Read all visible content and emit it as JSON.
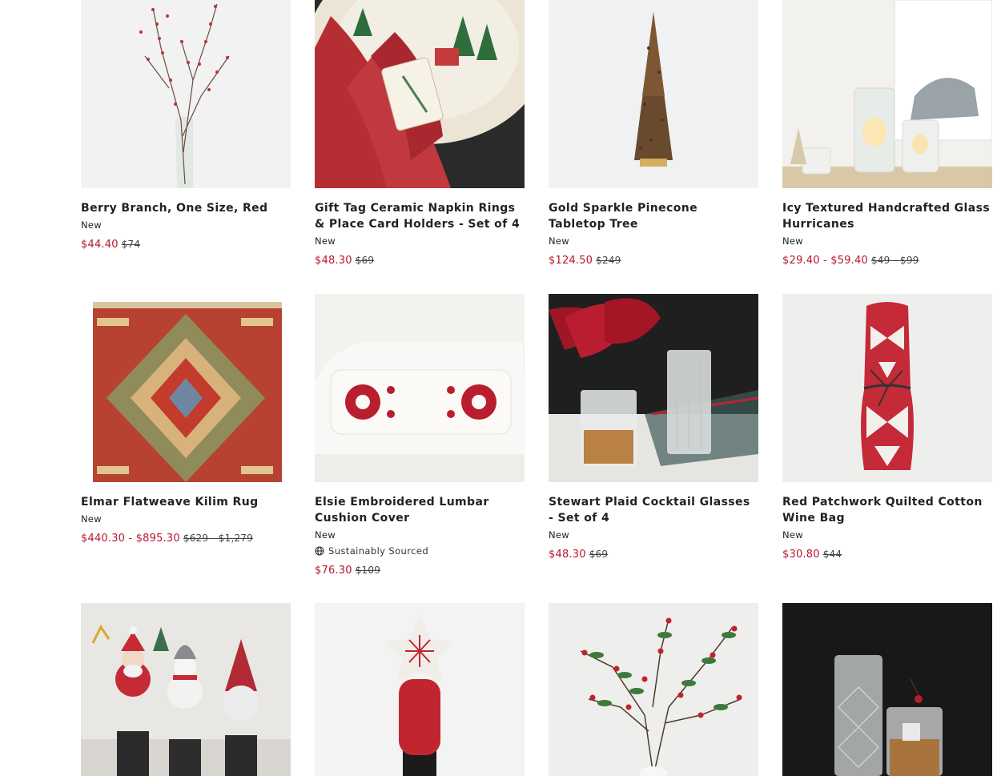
{
  "products": [
    {
      "name": "Berry Branch, One Size, Red",
      "badge": "New",
      "sale": "$44.40",
      "original": "$74"
    },
    {
      "name": "Gift Tag Ceramic Napkin Rings & Place Card Holders - Set of 4",
      "badge": "New",
      "sale": "$48.30",
      "original": "$69"
    },
    {
      "name": "Gold Sparkle Pinecone Tabletop Tree",
      "badge": "New",
      "sale": "$124.50",
      "original": "$249"
    },
    {
      "name": "Icy Textured Handcrafted Glass Hurricanes",
      "badge": "New",
      "sale": "$29.40 - $59.40",
      "original": "$49 - $99"
    },
    {
      "name": "Elmar Flatweave Kilim Rug",
      "badge": "New",
      "sale": "$440.30 - $895.30",
      "original": "$629 - $1,279"
    },
    {
      "name": "Elsie Embroidered Lumbar Cushion Cover",
      "badge": "New",
      "sustainability": "Sustainably Sourced",
      "sale": "$76.30",
      "original": "$109"
    },
    {
      "name": "Stewart Plaid Cocktail Glasses - Set of 4",
      "badge": "New",
      "sale": "$48.30",
      "original": "$69"
    },
    {
      "name": "Red Patchwork Quilted Cotton Wine Bag",
      "badge": "New",
      "sale": "$30.80",
      "original": "$44"
    }
  ],
  "colors": {
    "sale": "#b8162c",
    "text": "#222222"
  },
  "icons": {
    "sustainability": "globe-icon"
  }
}
